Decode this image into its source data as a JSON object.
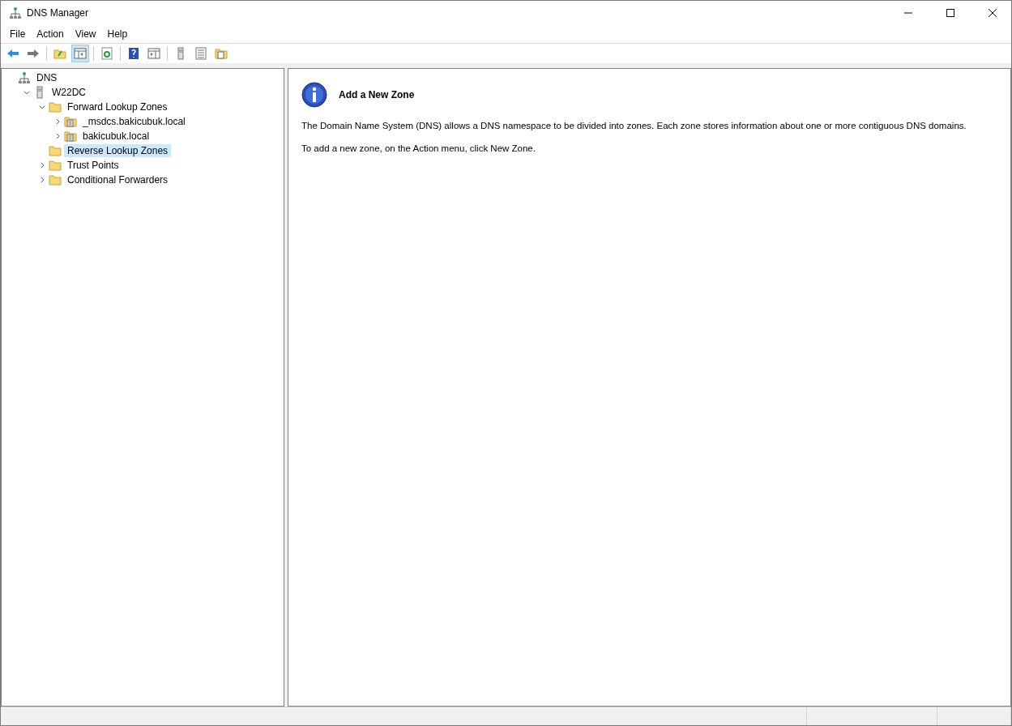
{
  "window": {
    "title": "DNS Manager"
  },
  "menu": [
    "File",
    "Action",
    "View",
    "Help"
  ],
  "toolbar": [
    {
      "kind": "back",
      "pressed": false
    },
    {
      "kind": "forward",
      "pressed": false
    },
    {
      "kind": "sep"
    },
    {
      "kind": "up-folder",
      "pressed": false
    },
    {
      "kind": "tree-pane",
      "pressed": true
    },
    {
      "kind": "sep"
    },
    {
      "kind": "refresh",
      "pressed": false
    },
    {
      "kind": "sep"
    },
    {
      "kind": "help",
      "pressed": false
    },
    {
      "kind": "action-pane",
      "pressed": false
    },
    {
      "kind": "sep"
    },
    {
      "kind": "server",
      "pressed": false
    },
    {
      "kind": "list",
      "pressed": false
    },
    {
      "kind": "zone-folder",
      "pressed": false
    }
  ],
  "tree": [
    {
      "label": "DNS",
      "kind": "dns",
      "selected": false,
      "children": [
        {
          "label": "W22DC",
          "kind": "server",
          "expanded": true,
          "selected": false,
          "children": [
            {
              "label": "Forward Lookup Zones",
              "kind": "folder",
              "expanded": true,
              "selected": false,
              "children": [
                {
                  "label": "_msdcs.bakicubuk.local",
                  "kind": "zone",
                  "expanded": false,
                  "selected": false,
                  "has_children": true
                },
                {
                  "label": "bakicubuk.local",
                  "kind": "zone",
                  "expanded": false,
                  "selected": false,
                  "has_children": true
                }
              ]
            },
            {
              "label": "Reverse Lookup Zones",
              "kind": "folder",
              "expanded": false,
              "selected": true,
              "has_children": false
            },
            {
              "label": "Trust Points",
              "kind": "folder",
              "expanded": false,
              "selected": false,
              "has_children": true
            },
            {
              "label": "Conditional Forwarders",
              "kind": "folder",
              "expanded": false,
              "selected": false,
              "has_children": true
            }
          ]
        }
      ]
    }
  ],
  "content": {
    "heading": "Add a New Zone",
    "paragraphs": [
      "The Domain Name System (DNS) allows a DNS namespace to be divided into zones. Each zone stores information about one or more contiguous DNS domains.",
      "To add a new zone, on the Action menu, click New Zone."
    ]
  }
}
